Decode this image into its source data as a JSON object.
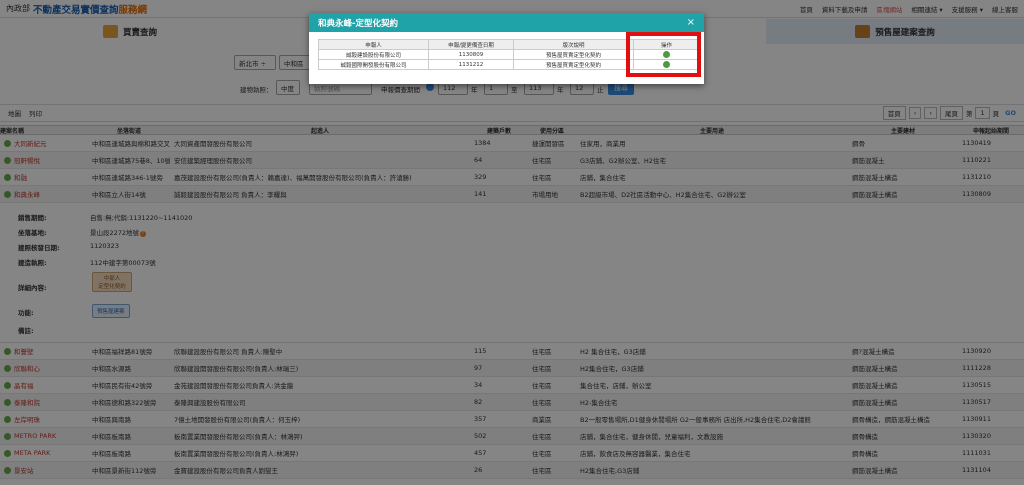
{
  "header": {
    "seal": "內政部",
    "title_a": "不動產交易實價查詢",
    "title_b": "服務網",
    "nav": [
      "首頁",
      "資料下載及申請",
      "區塊網站",
      "相關連結 ▾",
      "支援服務 ▾",
      "線上客服"
    ]
  },
  "tabs": {
    "left": "買賣查詢",
    "right": "預售屋建案查詢"
  },
  "filters": {
    "city": "新北市 ÷",
    "district": "中和區",
    "build_label": "建物執照：",
    "build_prefix": "中度",
    "build_placeholder": "執照號碼",
    "period_label": "申報價查期間",
    "y1": "112",
    "m1": "1",
    "to": "至",
    "y2": "113",
    "m2": "12",
    "unit_year": "年",
    "unit_month": "止",
    "search": "搜尋"
  },
  "toolbar": {
    "map": "地圖",
    "print": "列印",
    "first": "首頁",
    "prev": "‹",
    "next": "›",
    "last": "尾頁",
    "page_prefix": "第",
    "page": "1",
    "page_suffix": "頁",
    "go": "GO"
  },
  "table": {
    "headers": [
      "建案名稱",
      "坐落街道",
      "起造人",
      "建築戶數",
      "使用分區",
      "主要用途",
      "主要建材",
      "申報起始期間"
    ],
    "rows_top": [
      [
        "大同新紀元",
        "中和區連城路與棉和路交叉口",
        "大同資產開發股份有限公司",
        "1384",
        "捷運開發區",
        "住家用，商業用",
        "鋼骨",
        "1130419"
      ],
      [
        "冠軒暢悅",
        "中和區連城路75巷8、10號",
        "安信建築經理股份有限公司",
        "64",
        "住宅區",
        "G3店鋪、G2辦公室、H2住宅",
        "鋼筋混凝土",
        "1110221"
      ],
      [
        "和融",
        "中和區連城路346-1號旁",
        "嘉茂建設股份有限公司(負責人：賴嘉達)、福萬開發股份有限公司(負責人：許滄勝)",
        "329",
        "住宅區",
        "店鋪，集合住宅",
        "鋼筋混凝土構造",
        "1131210"
      ],
      [
        "和典永峰",
        "中和區立人街14號",
        "誠毅建設股份有限公司 負責人：李耀與",
        "141",
        "市場用地",
        "B2超級市場、D2社區活動中心、H2集合住宅、G2辦公室",
        "鋼筋混凝土構造",
        "1130809"
      ]
    ],
    "rows_bottom": [
      [
        "和豐壁",
        "中和區福祥路81號旁",
        "欣聯建設股份有限公司 負責人:陳聖中",
        "115",
        "住宅區",
        "H2 集合住宅，G3店鋪",
        "鋼?混凝土構造",
        "1130920"
      ],
      [
        "欣聯和心",
        "中和區水源路",
        "欣聯建設開發股份有限公司(負責人:林瑞三)",
        "97",
        "住宅區",
        "H2集合住宅，G3店鋪",
        "鋼筋混凝土構造",
        "1111228"
      ],
      [
        "晶有福",
        "中和區民有街42號旁",
        "金苑建設開發股份有限公司負責人:洪金龍",
        "34",
        "住宅區",
        "集合住宅，店鋪，辦公室",
        "鋼筋混凝土構造",
        "1130515"
      ],
      [
        "泰隆和院",
        "中和區德和路322號旁",
        "泰隆興建設股份有限公司",
        "82",
        "住宅區",
        "H2-集合住宅",
        "鋼筋混凝土構造",
        "1130517"
      ],
      [
        "左岸明珠",
        "中和區興南路",
        "7億土地開發股份有限公司(負責人：何玉梓)",
        "357",
        "商業區",
        "B2一般零售場所,D1健身休閒場所 G2一般事務所 店出所,H2集合住宅,D2會議館",
        "鋼骨構造，鋼筋混凝土構造",
        "1130911"
      ],
      [
        "METRO PARK",
        "中和區板南路",
        "板南置業開發股份有限公司(負責人：林鴻羿)",
        "502",
        "住宅區",
        "店鋪，集合住宅，健身休閒，兒童福利，文教設施",
        "鋼骨構造",
        "1130320"
      ],
      [
        "META PARK",
        "中和區板南路",
        "板南置業開發股份有限公司(負責人:林鴻羿)",
        "457",
        "住宅區",
        "店鋪，飲食店及無容器醫業，集合住宅",
        "鋼骨構造",
        "1111031"
      ],
      [
        "景安站",
        "中和區景新街112號旁",
        "金寶建設股份有限公司負責人劉燮王",
        "26",
        "住宅區",
        "H2集合住宅,G3店鋪",
        "鋼筋混凝土構造",
        "1131104"
      ]
    ]
  },
  "detail": {
    "labels": [
      "銷售期間:",
      "坐落基地:",
      "建照核發日期:",
      "建造執照:",
      "詳細內容:",
      "功能:",
      "備註:"
    ],
    "sales": "自售:無;代銷:1131220~1141020",
    "site": "景山段2272地號",
    "site_warn": "!",
    "issue_date": "1120323",
    "license": "112中建字第00073號",
    "detail_btn_a": "中部人",
    "detail_btn_b": "定型化契約",
    "func_btn": "預售屋建案"
  },
  "modal": {
    "title": "和典永峰-定型化契約",
    "close": "×",
    "headers": [
      "申報人",
      "申報/變更備查日期",
      "版次說明",
      "操作"
    ],
    "rows": [
      [
        "誠毅建設股份有限公司",
        "1130809",
        "預售屋買賣定型化契約"
      ],
      [
        "誠毅國際開發股份有限公司",
        "1131212",
        "預售屋買賣定型化契約"
      ]
    ]
  },
  "colors": {
    "accent": "#1fa2a8",
    "highlight": "#e01010"
  }
}
